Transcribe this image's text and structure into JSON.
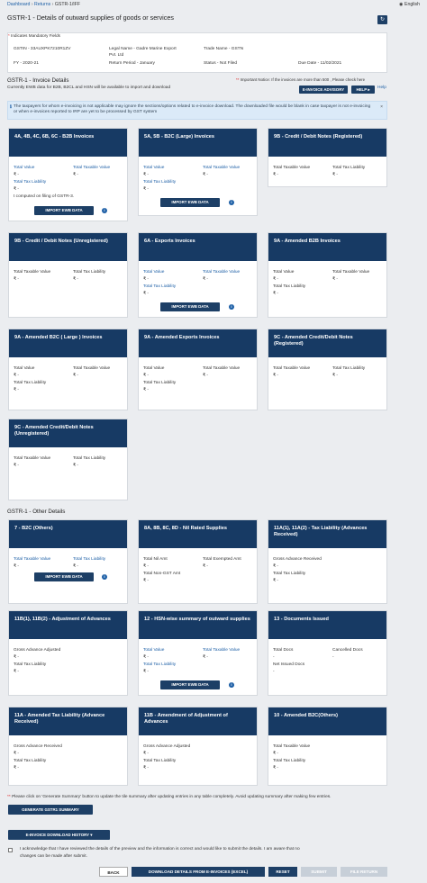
{
  "breadcrumb": {
    "items": [
      "Dashboard",
      "Returns",
      "GSTR-1/IFF"
    ],
    "sep": "›"
  },
  "language": "English",
  "page_title": "GSTR-1 - Details of outward supplies of goods or services",
  "mandatory_note": "Indicates Mandatory Fields",
  "info": {
    "gstin": "GSTIN - 33AUXPK7210R1ZV",
    "legal_name_1": "Legal Name - Gadre Marine Export",
    "legal_name_2": "Pvt. Ltd",
    "trade_name": "Trade Name - GSTN",
    "fy": "FY - 2020-21",
    "return_period": "Return Period - January",
    "status": "Status - Not Filed",
    "due_date": "Due Date - 11/02/2021"
  },
  "invoice_section": {
    "title": "GSTR-1 - Invoice Details",
    "subtitle": "Currently EWB data for B2B, B2CL and HSN will be available to import and download",
    "important_notice": "Important Notice: If the invoices are more than 500 , Please check here",
    "einvoice_advisory": "E-INVOICE ADVISORY",
    "help": "HELP",
    "help_link": "Help",
    "blue_notice": "The taxpayers for whom e-invoicing is not applicable may ignore the sections/options related to e-invoice download. The downloaded file would be blank in case taxpayer is not e-invoicing or when e-invoices reported to IRP are yet to be processed by GST system"
  },
  "tiles": [
    {
      "title": "4A, 4B, 4C, 6B, 6C - B2B Invoices",
      "lbl1": "Total Value",
      "lbl2": "Total Taxable Value",
      "v1": "₹ -",
      "v2": "₹ -",
      "lbl3": "Total Tax Liability",
      "v3": "₹ -",
      "note": "t computed on filing of GSTR-3.",
      "button": "IMPORT EWB DATA"
    },
    {
      "title": "5A, 5B - B2C (Large) Invoices",
      "lbl1": "Total Value",
      "lbl2": "Total Taxable Value",
      "v1": "₹ -",
      "v2": "₹ -",
      "lbl3": "Total Tax Liability",
      "v3": "₹ -",
      "button": "IMPORT EWB DATA"
    },
    {
      "title": "9B - Credit / Debit Notes (Registered)",
      "lbl1": "Total Taxable Value",
      "lbl2": "Total Tax Liability",
      "v1": "₹ -",
      "v2": "₹ -"
    },
    {
      "title": "9B - Credit / Debit Notes (Unregistered)",
      "lbl1": "Total Taxable Value",
      "lbl2": "Total Tax Liability",
      "v1": "₹ -",
      "v2": "₹ -"
    },
    {
      "title": "6A - Exports Invoices",
      "lbl1": "Total Value",
      "lbl2": "Total Taxable Value",
      "v1": "₹ -",
      "v2": "₹ -",
      "lbl3": "Total Tax Liability",
      "v3": "₹ -",
      "button": "IMPORT EWB DATA"
    },
    {
      "title": "9A - Amended B2B Invoices",
      "lbl1": "Total Value",
      "lbl2": "Total Taxable Value",
      "v1": "₹ -",
      "v2": "₹ -",
      "lbl3": "Total Tax Liability",
      "v3": "₹ -"
    },
    {
      "title": "9A - Amended B2C ( Large ) Invoices",
      "lbl1": "Total Value",
      "lbl2": "Total Taxable Value",
      "v1": "₹ -",
      "v2": "₹ -",
      "lbl3": "Total Tax Liability",
      "v3": "₹ -"
    },
    {
      "title": "9A - Amended Exports Invoices",
      "lbl1": "Total Value",
      "lbl2": "Total Taxable Value",
      "v1": "₹ -",
      "v2": "₹ -",
      "lbl3": "Total Tax Liability",
      "v3": "₹ -"
    },
    {
      "title": "9C - Amended Credit/Debit Notes (Registered)",
      "lbl1": "Total Taxable Value",
      "lbl2": "Total Tax Liability",
      "v1": "₹ -",
      "v2": "₹ -"
    },
    {
      "title": "9C - Amended Credit/Debit Notes (Unregistered)",
      "lbl1": "Total Taxable Value",
      "lbl2": "Total Tax Liability",
      "v1": "₹ -",
      "v2": "₹ -"
    }
  ],
  "other_section": {
    "title": "GSTR-1 - Other Details"
  },
  "other_tiles": [
    {
      "title": "7 - B2C (Others)",
      "lbl1": "Total Taxable Value",
      "lbl2": "Total Tax Liability",
      "v1": "₹ -",
      "v2": "₹ -",
      "button": "IMPORT EWB DATA"
    },
    {
      "title": "8A, 8B, 8C, 8D - Nil Rated Supplies",
      "lbl1": "Total Nil Amt",
      "lbl2": "Total Exempted Amt",
      "v1": "₹ -",
      "v2": "₹ -",
      "lbl3": "Total Non-GST Amt",
      "v3": "₹ -"
    },
    {
      "title": "11A(1), 11A(2) - Tax Liability (Advances Received)",
      "lbl1": "Gross Advance Received",
      "v1": "₹ -",
      "lbl3": "Total Tax Liability",
      "v3": "₹ -"
    },
    {
      "title": "11B(1), 11B(2) - Adjustment of Advances",
      "lbl1": "Gross Advance Adjusted",
      "v1": "₹ -",
      "lbl3": "Total Tax Liability",
      "v3": "₹ -"
    },
    {
      "title": "12 - HSN-wise summary of outward supplies",
      "lbl1": "Total Value",
      "lbl2": "Total Taxable Value",
      "v1": "₹ -",
      "v2": "₹ -",
      "lbl3": "Total Tax Liability",
      "v3": "₹ -",
      "button": "IMPORT EWB DATA"
    },
    {
      "title": "13 - Documents Issued",
      "lbl1": "Total Docs",
      "lbl2": "Cancelled Docs",
      "v1": "-",
      "v2": "-",
      "lbl3": "Net Issued Docs",
      "v3": "-"
    },
    {
      "title": "11A - Amended Tax Liability (Advance Received)",
      "lbl1": "Gross Advance Received",
      "v1": "₹ -",
      "lbl3": "Total Tax Liability",
      "v3": "₹ -"
    },
    {
      "title": "11B - Amendment of Adjustment of Advances",
      "lbl1": "Gross Advance Adjusted",
      "v1": "₹ -",
      "lbl3": "Total Tax Liability",
      "v3": "₹ -"
    },
    {
      "title": "10 - Amended B2C(Others)",
      "lbl1": "Total Taxable Value",
      "v1": "₹ -",
      "lbl3": "Total Tax Liability",
      "v3": "₹ -"
    }
  ],
  "footer": {
    "note": "Please click on 'Generate Summary' button to update the tile summary after updating entries in any table completely. Avoid updating summary after making few entries.",
    "generate_btn": "GENERATE GSTR1 SUMMARY",
    "history_btn": "E-INVOICE DOWNLOAD HISTORY",
    "ack_1": "I acknowledge that I have reviewed the details of the preview and the information is correct and would like to submit the details. I am aware that no",
    "ack_2": "changes can be made after submit.",
    "back": "BACK",
    "download": "DOWNLOAD DETAILS FROM E-INVOICES (EXCEL)",
    "reset": "RESET",
    "submit": "SUBMIT",
    "file_return": "FILE RETURN"
  },
  "colors": {
    "tile_header": "#173a64",
    "link": "#1d5fa6",
    "bg": "#ebedf0"
  }
}
